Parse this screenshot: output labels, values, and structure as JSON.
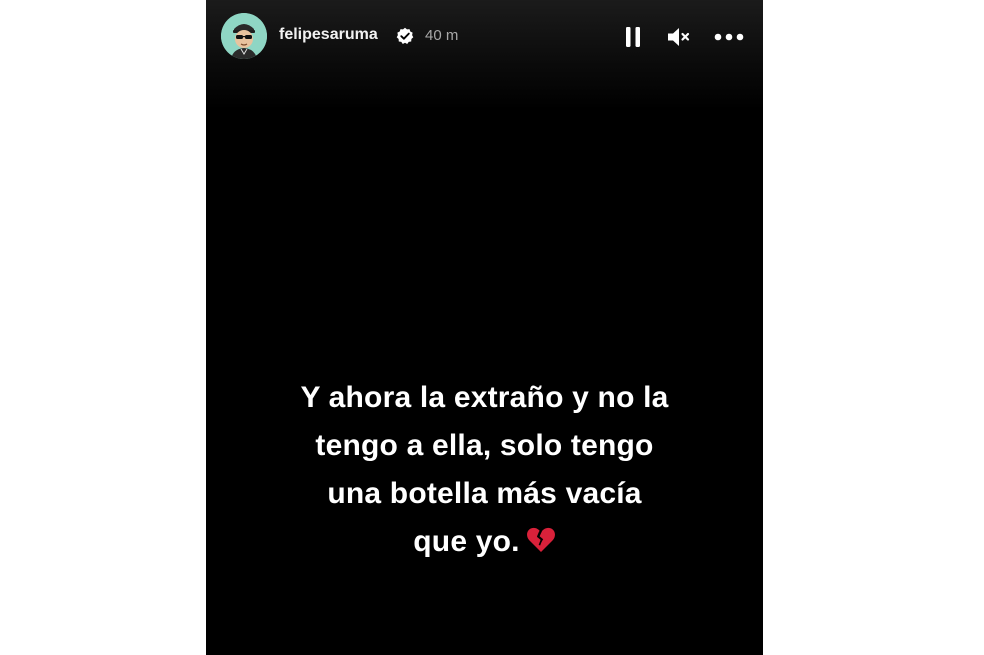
{
  "story": {
    "username": "felipesaruma",
    "timestamp": "40 m",
    "verified": true,
    "avatar_color": "#8fd6c4",
    "background": "#000000",
    "caption_lines": [
      "Y ahora la extraño y no la",
      "tengo a ella, solo tengo",
      "una botella más vacía",
      "que yo."
    ],
    "caption_emoji": "broken-heart-icon"
  },
  "controls": {
    "pause_icon": "pause-icon",
    "mute_icon": "volume-muted-icon",
    "more_icon": "more-options-icon"
  }
}
